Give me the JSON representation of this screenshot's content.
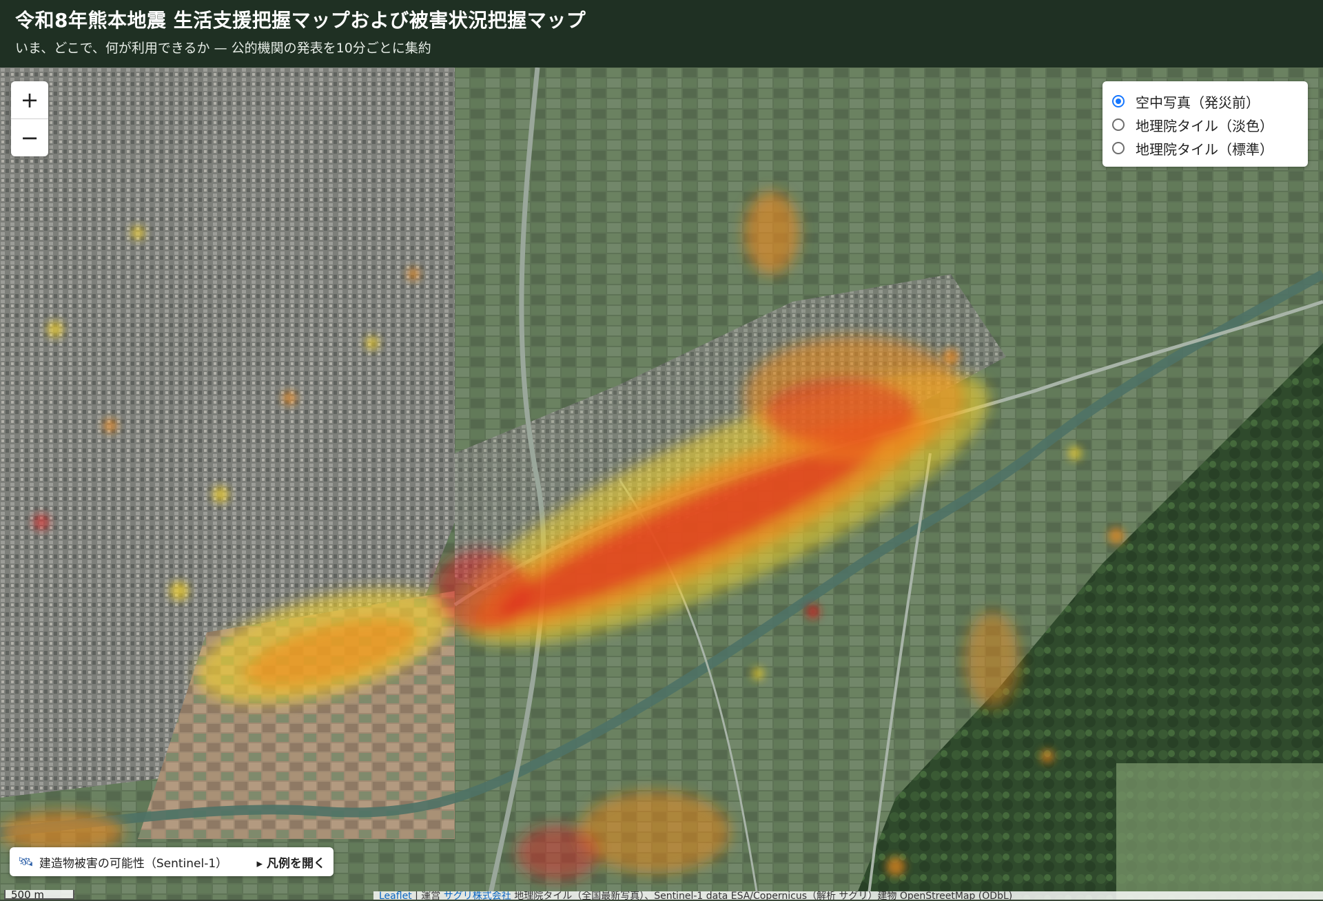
{
  "header": {
    "title": "令和8年熊本地震 生活支援把握マップおよび被害状況把握マップ",
    "subtitle": "いま、どこで、何が利用できるか — 公的機関の発表を10分ごとに集約"
  },
  "zoom": {
    "in_label": "+",
    "out_label": "−"
  },
  "basemap_options": [
    {
      "label": "空中写真（発災前）",
      "selected": true
    },
    {
      "label": "地理院タイル（淡色）",
      "selected": false
    },
    {
      "label": "地理院タイル（標準）",
      "selected": false
    }
  ],
  "legend": {
    "icon": "satellite-icon",
    "label": "建造物被害の可能性（Sentinel-1）",
    "open_label": "▸ 凡例を開く"
  },
  "scale_label": "500 m",
  "attribution": {
    "leaflet": "Leaflet",
    "operator_prefix": " | 運営 ",
    "operator_link": "サグリ株式会社",
    "rest": " 地理院タイル（全国最新写真）、Sentinel-1 data ESA/Copernicus（解析 サグリ）建物 OpenStreetMap (ODbL)"
  },
  "colors": {
    "header_bg": "#1f3023",
    "damage_high": "#e02020",
    "damage_mid": "#f08a1a",
    "damage_low": "#f3d22b",
    "radio_selected": "#1677ff"
  }
}
